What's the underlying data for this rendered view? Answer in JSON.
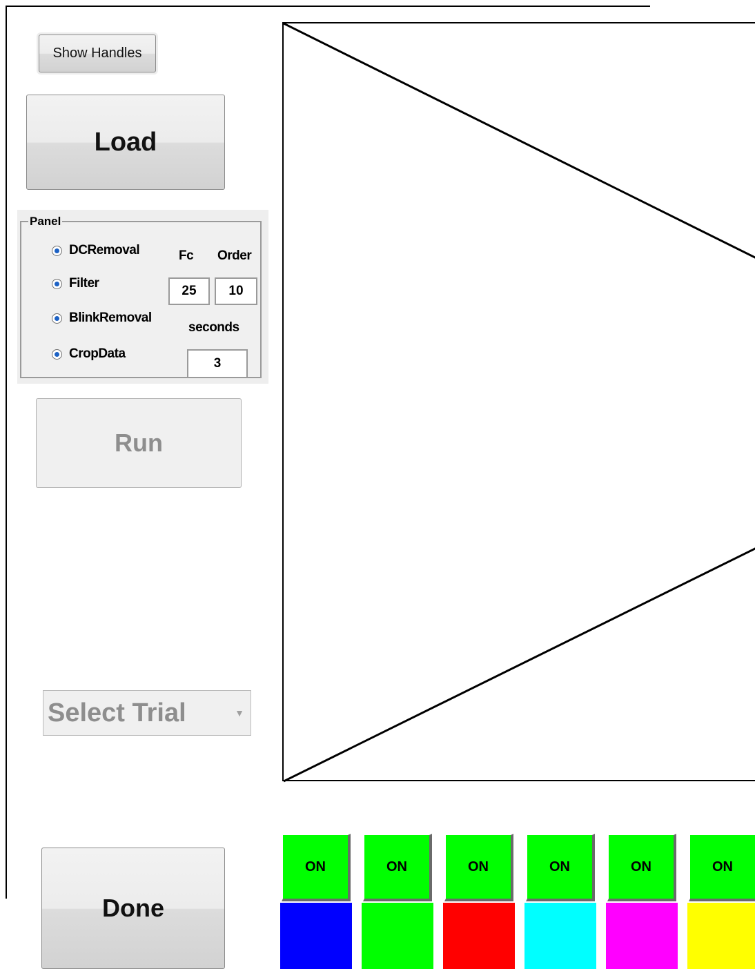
{
  "toolbar": {
    "show_handles_label": "Show Handles",
    "load_label": "Load",
    "run_label": "Run",
    "done_label": "Done"
  },
  "panel": {
    "title": "Panel",
    "options": [
      "DCRemoval",
      "Filter",
      "BlinkRemoval",
      "CropData"
    ],
    "fc_label": "Fc",
    "order_label": "Order",
    "fc_value": "25",
    "order_value": "10",
    "seconds_label": "seconds",
    "seconds_value": "3"
  },
  "trial_select": {
    "selected": "Select Trial",
    "arrow_icon": "chevron-down-icon"
  },
  "channels": [
    {
      "label": "ON",
      "color": "#0000ff"
    },
    {
      "label": "ON",
      "color": "#00ff00"
    },
    {
      "label": "ON",
      "color": "#ff0000"
    },
    {
      "label": "ON",
      "color": "#00ffff"
    },
    {
      "label": "ON",
      "color": "#ff00ff"
    },
    {
      "label": "ON",
      "color": "#ffff00"
    }
  ],
  "colors": {
    "toggle_on": "#00ff00",
    "disabled_text": "#8e8e8e"
  }
}
